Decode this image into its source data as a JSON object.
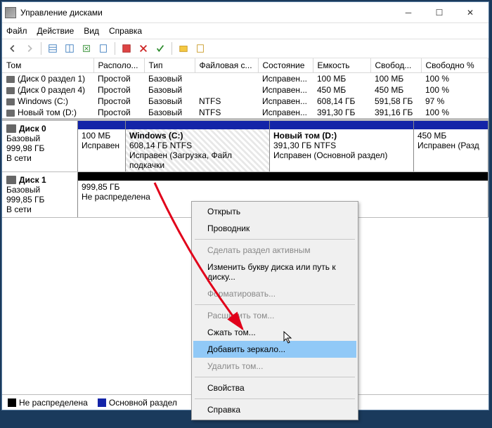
{
  "window": {
    "title": "Управление дисками"
  },
  "menu": {
    "file": "Файл",
    "action": "Действие",
    "view": "Вид",
    "help": "Справка"
  },
  "columns": {
    "volume": "Том",
    "layout": "Располо...",
    "type": "Тип",
    "fs": "Файловая с...",
    "status": "Состояние",
    "capacity": "Емкость",
    "free": "Свобод...",
    "freepct": "Свободно %"
  },
  "rows": [
    {
      "name": "(Диск 0 раздел 1)",
      "layout": "Простой",
      "type": "Базовый",
      "fs": "",
      "status": "Исправен...",
      "cap": "100 МБ",
      "free": "100 МБ",
      "pct": "100 %"
    },
    {
      "name": "(Диск 0 раздел 4)",
      "layout": "Простой",
      "type": "Базовый",
      "fs": "",
      "status": "Исправен...",
      "cap": "450 МБ",
      "free": "450 МБ",
      "pct": "100 %"
    },
    {
      "name": "Windows (C:)",
      "layout": "Простой",
      "type": "Базовый",
      "fs": "NTFS",
      "status": "Исправен...",
      "cap": "608,14 ГБ",
      "free": "591,58 ГБ",
      "pct": "97 %"
    },
    {
      "name": "Новый том (D:)",
      "layout": "Простой",
      "type": "Базовый",
      "fs": "NTFS",
      "status": "Исправен...",
      "cap": "391,30 ГБ",
      "free": "391,16 ГБ",
      "pct": "100 %"
    }
  ],
  "disk0": {
    "title": "Диск 0",
    "type": "Базовый",
    "size": "999,98 ГБ",
    "status": "В сети",
    "parts": [
      {
        "title": "",
        "size": "100 МБ",
        "status": "Исправен"
      },
      {
        "title": "Windows  (C:)",
        "size": "608,14 ГБ NTFS",
        "status": "Исправен (Загрузка, Файл подкачки"
      },
      {
        "title": "Новый том  (D:)",
        "size": "391,30 ГБ NTFS",
        "status": "Исправен (Основной раздел)"
      },
      {
        "title": "",
        "size": "450 МБ",
        "status": "Исправен (Разд"
      }
    ]
  },
  "disk1": {
    "title": "Диск 1",
    "type": "Базовый",
    "size": "999,85 ГБ",
    "status": "В сети",
    "parts": [
      {
        "title": "",
        "size": "999,85 ГБ",
        "status": "Не распределена"
      }
    ]
  },
  "legend": {
    "unalloc": "Не распределена",
    "primary": "Основной раздел"
  },
  "context": {
    "open": "Открыть",
    "explorer": "Проводник",
    "active": "Сделать раздел активным",
    "letter": "Изменить букву диска или путь к диску...",
    "format": "Форматировать...",
    "extend": "Расширить том...",
    "shrink": "Сжать том...",
    "mirror": "Добавить зеркало...",
    "delete": "Удалить том...",
    "props": "Свойства",
    "help": "Справка"
  }
}
